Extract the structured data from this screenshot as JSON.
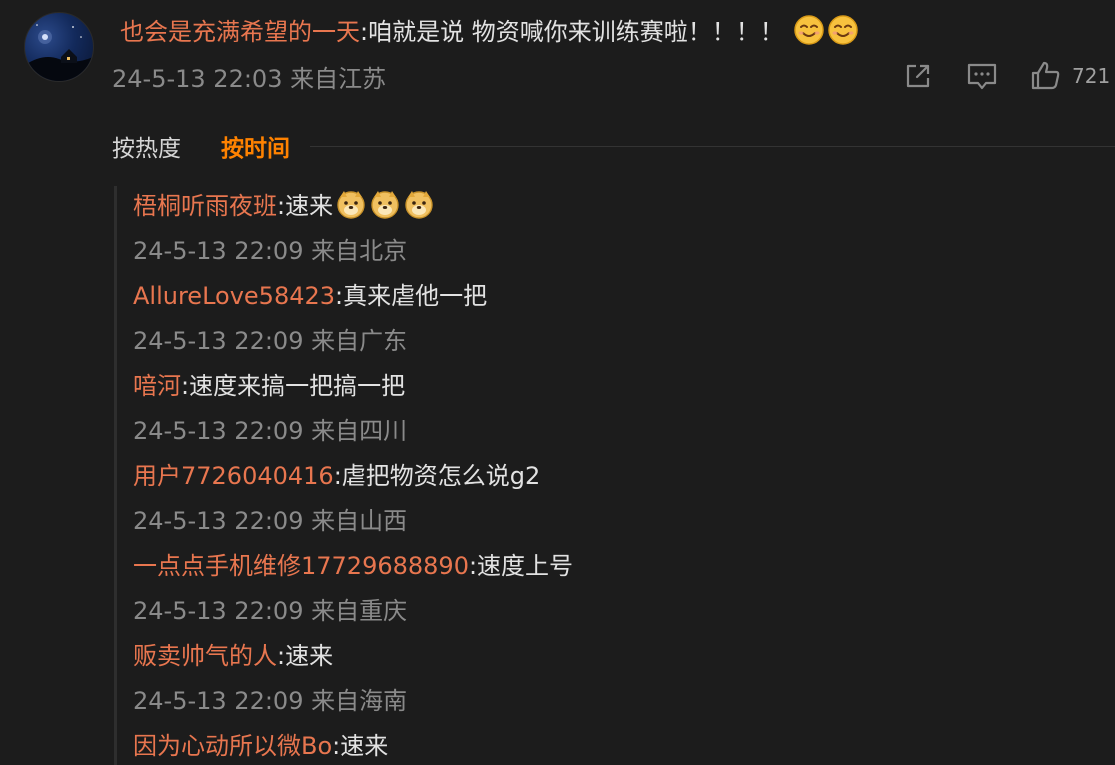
{
  "main_comment": {
    "username": "也会是充满希望的一天",
    "text": ":咱就是说 物资喊你来训练赛啦！！！！",
    "emojis": [
      "smile-emoji",
      "smile-emoji"
    ],
    "meta": "24-5-13 22:03 来自江苏",
    "like_count": "721"
  },
  "icons": {
    "share": "share-icon",
    "comment": "comment-icon",
    "like": "thumbs-up-icon"
  },
  "sort": {
    "hot_label": "按热度",
    "time_label": "按时间",
    "active": "time",
    "active_color": "#ff8200"
  },
  "colors": {
    "background": "#1c1c1c",
    "username": "#e8764f",
    "meta": "#8a8a8a",
    "text": "#e2e2e2"
  },
  "replies": [
    {
      "username": "梧桐听雨夜班",
      "text": ":速来",
      "emojis": [
        "doge-emoji",
        "doge-emoji",
        "doge-emoji"
      ],
      "meta": "24-5-13 22:09 来自北京"
    },
    {
      "username": "AllureLove58423",
      "text": ":真来虐他一把",
      "emojis": [],
      "meta": "24-5-13 22:09 来自广东"
    },
    {
      "username": "喑河",
      "text": ":速度来搞一把搞一把",
      "emojis": [],
      "meta": "24-5-13 22:09 来自四川"
    },
    {
      "username": "用户7726040416",
      "text": ":虐把物资怎么说g2",
      "emojis": [],
      "meta": "24-5-13 22:09 来自山西"
    },
    {
      "username": "一点点手机维修17729688890",
      "text": ":速度上号",
      "emojis": [],
      "meta": "24-5-13 22:09 来自重庆"
    },
    {
      "username": "贩卖帅气的人",
      "text": ":速来",
      "emojis": [],
      "meta": "24-5-13 22:09 来自海南"
    },
    {
      "username": "因为心动所以微Bo",
      "text": ":速来",
      "emojis": [],
      "meta": ""
    }
  ]
}
